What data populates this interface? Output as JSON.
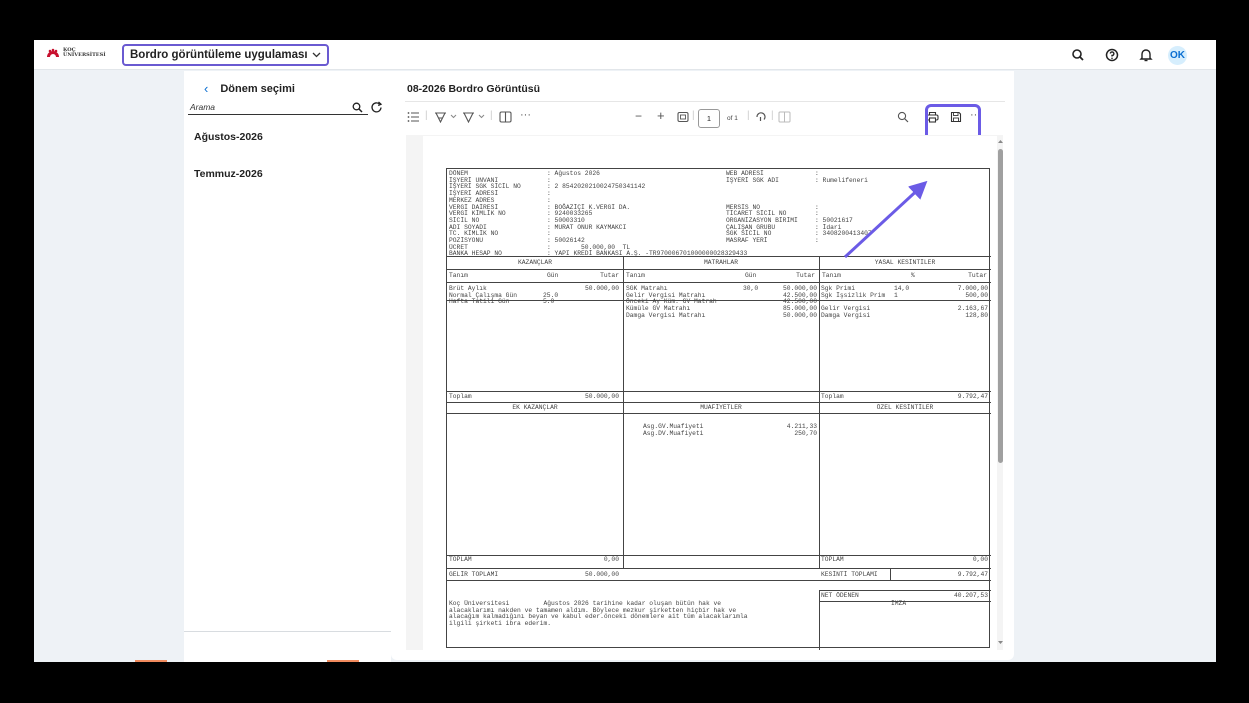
{
  "shellbar": {
    "logo_line1": "KOÇ",
    "logo_line2": "ÜNİVERSİTESİ",
    "app_selector": "Bordro görüntüleme uygulaması",
    "avatar": "OK",
    "icons": [
      "search-icon",
      "help-icon",
      "bell-icon"
    ]
  },
  "left": {
    "back_label": "Dönem seçimi",
    "search_placeholder": "Arama",
    "months": [
      "Ağustos-2026",
      "Temmuz-2026"
    ]
  },
  "page": {
    "title": "08-2026 Bordro Görüntüsü"
  },
  "toolbar": {
    "page_number": "1",
    "page_of": "of 1"
  },
  "doc": {
    "header_labels": [
      "DÖNEM",
      "İŞYERİ UNVANI",
      "İŞYERİ SGK SİCİL NO",
      "İŞYERİ ADRESİ",
      "MERKEZ ADRES",
      "VERGİ DAİRESİ",
      "VERGİ KİMLİK NO",
      "SİCİL NO",
      "ADI SOYADI",
      "TC. KİMLİK NO",
      "POZİSYONU",
      "ÜCRET",
      "BANKA HESAP NO"
    ],
    "header_values": [
      ": Ağustos 2026",
      ":",
      ": 2 8542020210024750341142",
      ":",
      ":",
      ": BOĞAZİÇİ K.VERGİ DA.",
      ": 9240033265",
      ": 50003310",
      ": MURAT ONUR KAYMAKCI",
      ":",
      ": 50026142",
      ":        50.000,00  TL",
      ": YAPI KREDİ BANKASI A.Ş. -TR970006701000000028329433"
    ],
    "header_labels2": [
      "WEB ADRESİ",
      "İŞYERİ SGK ADI",
      "",
      "",
      "",
      "MERSİS NO",
      "TİCARET SİCİL NO",
      "ORGANİZASYON BİRİMİ",
      "ÇALIŞAN GRUBU",
      "SGK SİCİL NO",
      "MASRAF YERİ"
    ],
    "header_values2": [
      ":",
      ": Rumelifeneri",
      "",
      "",
      "",
      ":",
      ":",
      ": 50021617",
      ": İdari",
      ": 3408200413407",
      ":"
    ],
    "sec_kazanc": "KAZANÇLAR",
    "sec_matrah": "MATRAHLAR",
    "sec_yasal": "YASAL KESİNTİLER",
    "col_tanim": "Tanım",
    "col_gun": "Gün",
    "col_tutar": "Tutar",
    "col_pct": "%",
    "kazanc_rows": [
      [
        "Brüt Aylık",
        "",
        "50.000,00"
      ],
      [
        "Normal Çalışma Gün",
        "25.0",
        ""
      ],
      [
        "Hafta Tatili Gün",
        "5.0",
        ""
      ]
    ],
    "matrah_rows": [
      [
        "SGK Matrahı",
        "30,0",
        "50.000,00"
      ],
      [
        "Gelir Vergisi Matrahı",
        "",
        "42.500,00"
      ],
      [
        "Önceki Ay Küm. GV Matrah",
        "",
        "42.500,00"
      ],
      [
        "Kümüle GV Matrahı",
        "",
        "85.000,00"
      ],
      [
        "Damga Vergisi Matrahı",
        "",
        "50.000,00"
      ]
    ],
    "yasal_rows": [
      [
        "Sgk Primi",
        "14,0",
        "7.000,00"
      ],
      [
        "Sgk İşsizlik Prim",
        "1",
        "500,00"
      ],
      [
        "",
        "",
        ""
      ],
      [
        "Gelir Vergisi",
        "",
        "2.163,67"
      ],
      [
        "Damga Vergisi",
        "",
        "128,80"
      ]
    ],
    "toplam": "Toplam",
    "kazanc_total": "50.000,00",
    "yasal_total": "9.792,47",
    "sec_ek": "EK KAZANÇLAR",
    "sec_muaf": "MUAFİYETLER",
    "sec_ozel": "ÖZEL KESİNTİLER",
    "muaf_rows": [
      [
        "Asg.GV.Muafiyeti",
        "4.211,33"
      ],
      [
        "Asg.DV.Muafiyeti",
        "250,70"
      ]
    ],
    "toplam_caps": "TOPLAM",
    "ek_total": "0,00",
    "ozel_total": "0,00",
    "gelir_toplami_label": "GELİR TOPLAMI",
    "gelir_toplami": "50.000,00",
    "kesinti_toplami_label": "KESİNTİ TOPLAMI",
    "kesinti_toplami": "9.792,47",
    "net_label": "NET ÖDENEN",
    "net_value": "40.207,53",
    "imza": "İMZA",
    "footer_text": [
      "Koç Üniversitesi         Ağustos 2026 tarihine kadar oluşan bütün hak ve",
      "alacaklarımı nakden ve tamamen aldım. Böylece mezkur şirketten hiçbir hak ve",
      "alacağım kalmadığını beyan ve kabul eder.önceki dönemlere ait tüm alacaklarımla",
      "ilgili şirketi ibra ederim."
    ]
  },
  "colors": {
    "accent": "#0a6ed1",
    "highlight": "#6b5be6"
  }
}
